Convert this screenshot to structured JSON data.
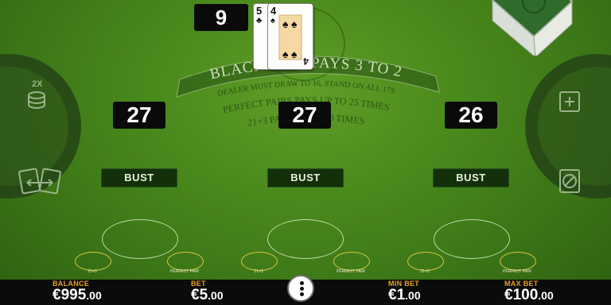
{
  "table": {
    "arc_title": "BLACKJACK PAYS 3 TO 2",
    "arc_line1": "DEALER MUST DRAW TO 16, STAND ON ALL 17S",
    "arc_line2": "PERFECT PAIRS PAYS UP TO 25 TIMES",
    "arc_line3": "21+3 PAYS UP TO 70 TIMES"
  },
  "dealer": {
    "total": "9",
    "cards": [
      {
        "rank": "5",
        "suit": "♣"
      },
      {
        "rank": "4",
        "suit": "♠"
      }
    ]
  },
  "hands": [
    {
      "total": "27",
      "status": "BUST",
      "side_left": "21+3",
      "side_right": "PERFECT PAIR"
    },
    {
      "total": "27",
      "status": "BUST",
      "side_left": "21+3",
      "side_right": "PERFECT PAIR"
    },
    {
      "total": "26",
      "status": "BUST",
      "side_left": "21+3",
      "side_right": "PERFECT PAIR"
    }
  ],
  "controls": {
    "double_label": "2X"
  },
  "footer": {
    "balance_label": "BALANCE",
    "balance_value": "€995",
    "balance_cents": ".00",
    "bet_label": "BET",
    "bet_value": "€5",
    "bet_cents": ".00",
    "min_label": "MIN BET",
    "min_value": "€1",
    "min_cents": ".00",
    "max_label": "MAX BET",
    "max_value": "€100",
    "max_cents": ".00"
  },
  "colors": {
    "felt": "#4a8a1c",
    "footer_label": "#e7a21d",
    "side_bet_ring": "#d6c640"
  }
}
